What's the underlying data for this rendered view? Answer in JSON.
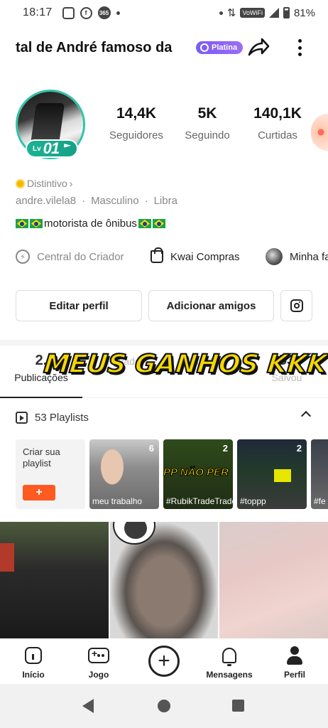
{
  "status_bar": {
    "time": "18:17",
    "icons_left": [
      "instagram-icon",
      "facebook-icon",
      "365-app-icon"
    ],
    "app365_label": "365",
    "volte_label": "VoWiFi",
    "battery": "81%"
  },
  "header": {
    "title": "tal de André famoso da",
    "badge": "Platina"
  },
  "profile": {
    "level_prefix": "Lv",
    "level": "01",
    "stats": [
      {
        "value": "14,4K",
        "label": "Seguidores"
      },
      {
        "value": "5K",
        "label": "Seguindo"
      },
      {
        "value": "140,1K",
        "label": "Curtidas"
      }
    ],
    "distintivo": "Distintivo",
    "username": "andre.vilela8",
    "gender": "Masculino",
    "sign": "Libra",
    "bio": "motorista de ônibus"
  },
  "tools": {
    "creator": "Central do Criador",
    "shop": "Kwai Compras",
    "mine": "Minha fa"
  },
  "buttons": {
    "edit": "Editar perfil",
    "add_friends": "Adicionar amigos"
  },
  "tabs": [
    {
      "count": "2,",
      "label": "Publicações"
    },
    {
      "count": "",
      "label": "Privado"
    },
    {
      "count": "",
      "label": "Curtidas"
    },
    {
      "count": "53",
      "label": "Salvou"
    }
  ],
  "overlay_text": "MEUS GANHOS KKK",
  "playlists": {
    "header": "53 Playlists",
    "create_label": "Criar sua playlist",
    "create_button": "+",
    "cards": [
      {
        "count": "6",
        "caption": "meu trabalho",
        "banner": ""
      },
      {
        "count": "2",
        "caption": "#RubikTradeTradeforBeginn...",
        "banner": "PP NÃO PER"
      },
      {
        "count": "2",
        "caption": "#toppp",
        "banner": ""
      },
      {
        "count": "",
        "caption": "#fe #n",
        "banner": ""
      }
    ]
  },
  "bottom_nav": {
    "home": "Início",
    "game": "Jogo",
    "create": "+",
    "messages": "Mensagens",
    "profile": "Perfil"
  },
  "colors": {
    "accent_orange": "#ff5a1f",
    "level_green": "#1bb394",
    "badge_purple": "#7b5cf0",
    "overlay_yellow": "#f5d800"
  }
}
